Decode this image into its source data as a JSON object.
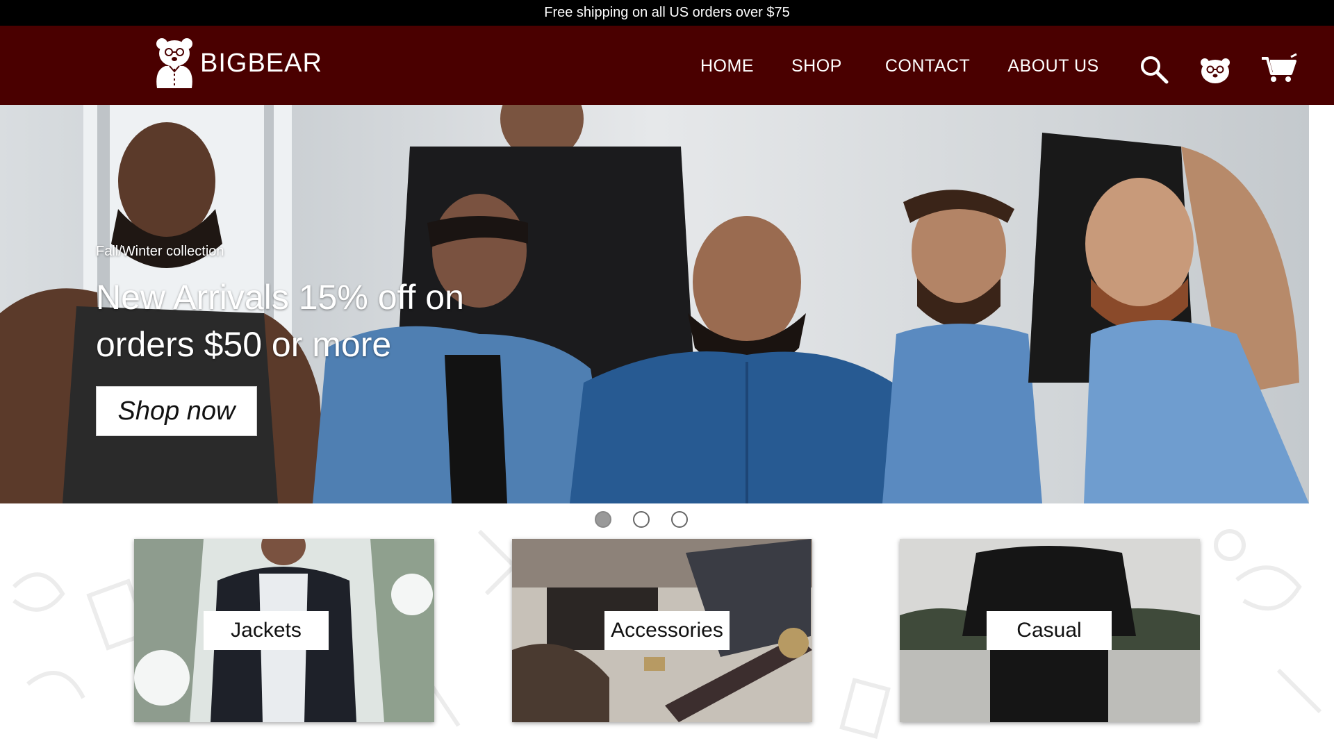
{
  "promo": {
    "text": "Free shipping on all US orders over $75"
  },
  "brand": {
    "logo_text": "BIGBEAR",
    "color_header": "#4a0000"
  },
  "nav": {
    "items": [
      {
        "label": "HOME"
      },
      {
        "label": "SHOP"
      },
      {
        "label": "CONTACT"
      },
      {
        "label": "ABOUT US"
      }
    ],
    "icons": [
      "search-icon",
      "bear-account-icon",
      "cart-icon"
    ]
  },
  "hero": {
    "eyebrow": "Fall/Winter collection",
    "headline": "New Arrivals 15% off on orders $50 or more",
    "cta_label": "Shop now",
    "slides_total": 3,
    "active_slide": 1
  },
  "categories": [
    {
      "label": "Jackets"
    },
    {
      "label": "Accessories"
    },
    {
      "label": "Casual"
    }
  ]
}
